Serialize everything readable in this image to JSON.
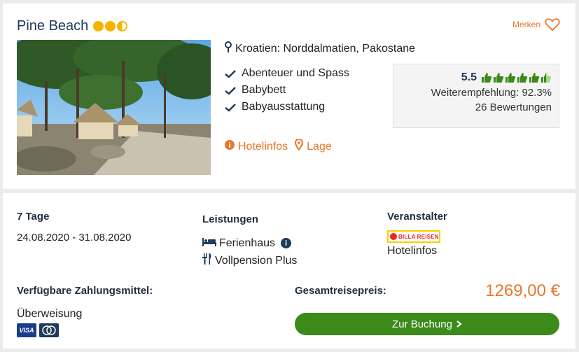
{
  "hotel": {
    "name": "Pine Beach",
    "stars": 2.5,
    "save_label": "Merken",
    "location": "Kroatien: Norddalmatien, Pakostane",
    "features": [
      "Abenteuer und Spass",
      "Babybett",
      "Babyausstattung"
    ],
    "links": {
      "hotelinfos": "Hotelinfos",
      "lage": "Lage"
    }
  },
  "rating": {
    "score": "5.5",
    "thumbs": 5.5,
    "recommendation": "Weiterempfehlung: 92.3%",
    "reviews": "26 Bewertungen"
  },
  "offer": {
    "duration": "7 Tage",
    "dates": "24.08.2020 - 31.08.2020",
    "services_label": "Leistungen",
    "accommodation": "Ferienhaus",
    "board": "Vollpension Plus",
    "operator_label": "Veranstalter",
    "operator_logo_text": "BILLA REISEN",
    "operator_link": "Hotelinfos",
    "payment_label": "Verfügbare Zahlungsmittel:",
    "payment_method": "Überweisung",
    "payment_icons": [
      "visa-icon",
      "mastercard-icon"
    ],
    "total_label": "Gesamtreisepreis:",
    "price": "1269,00 €",
    "book_button": "Zur Buchung"
  },
  "colors": {
    "accent": "#e8772e",
    "title": "#1f3a5a",
    "button": "#3b8a1a",
    "star": "#f6b400",
    "thumb": "#3b8a1a"
  }
}
